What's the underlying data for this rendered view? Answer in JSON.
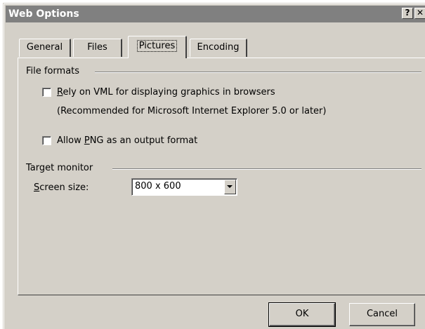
{
  "window": {
    "title": "Web Options",
    "help_label": "?",
    "close_label": "✕"
  },
  "tabs": [
    {
      "label": "General"
    },
    {
      "label": "Files"
    },
    {
      "label": "Pictures",
      "active": true
    },
    {
      "label": "Encoding"
    }
  ],
  "file_formats": {
    "group_label": "File formats",
    "vml_checkbox": {
      "label_first_char": "R",
      "label_rest": "ely on VML for displaying graphics in browsers",
      "checked": false
    },
    "vml_note": "(Recommended for Microsoft Internet Explorer 5.0 or later)",
    "png_checkbox": {
      "label_prefix": "Allow ",
      "label_underlined": "P",
      "label_rest": "NG as an output format",
      "checked": false
    }
  },
  "target_monitor": {
    "group_label": "Target monitor",
    "screen_size_label_first_char": "S",
    "screen_size_label_rest": "creen size:",
    "screen_size_value": "800 x 600"
  },
  "buttons": {
    "ok_label": "OK",
    "cancel_label": "Cancel"
  },
  "colors": {
    "dialog_face": "#d4d0c8",
    "titlebar": "#808080"
  }
}
